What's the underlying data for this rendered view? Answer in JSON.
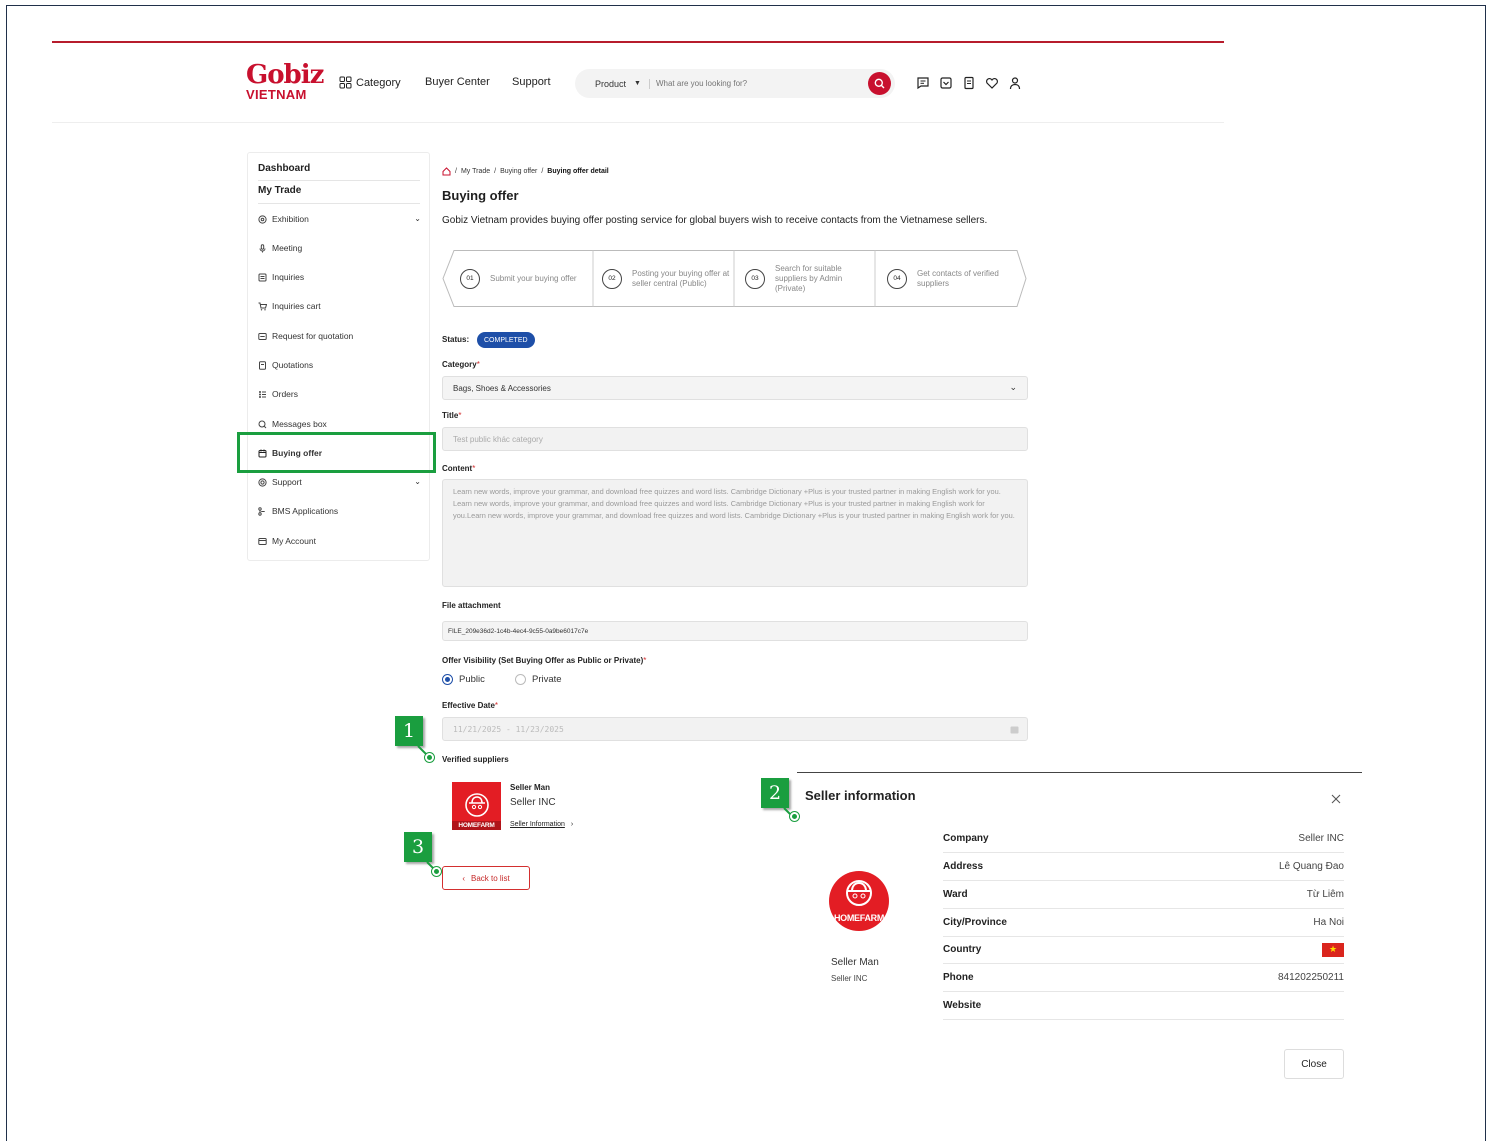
{
  "header": {
    "logo_line1": "Gobiz",
    "logo_line2": "VIETNAM",
    "nav": [
      "Category",
      "Buyer Center",
      "Support"
    ],
    "search_scope": "Product",
    "search_placeholder": "What are you looking for?"
  },
  "sidebar": {
    "dashboard": "Dashboard",
    "my_trade": "My Trade",
    "items": [
      {
        "label": "Exhibition",
        "icon": "gear-icon",
        "expandable": true
      },
      {
        "label": "Meeting",
        "icon": "mic-icon"
      },
      {
        "label": "Inquiries",
        "icon": "inbox-icon"
      },
      {
        "label": "Inquiries cart",
        "icon": "cart-icon"
      },
      {
        "label": "Request for quotation",
        "icon": "request-icon"
      },
      {
        "label": "Quotations",
        "icon": "quote-icon"
      },
      {
        "label": "Orders",
        "icon": "orders-icon"
      },
      {
        "label": "Messages box",
        "icon": "messages-icon"
      },
      {
        "label": "Buying offer",
        "icon": "offer-icon",
        "active": true
      },
      {
        "label": "Support",
        "icon": "support-icon",
        "expandable": true
      },
      {
        "label": "BMS Applications",
        "icon": "apps-icon"
      },
      {
        "label": "My Account",
        "icon": "account-icon"
      }
    ]
  },
  "breadcrumb": [
    "My Trade",
    "Buying offer",
    "Buying offer detail"
  ],
  "page": {
    "title": "Buying offer",
    "intro": "Gobiz Vietnam provides buying offer posting service for global buyers wish to receive contacts from the Vietnamese sellers."
  },
  "steps": [
    {
      "num": "01",
      "text": "Submit your buying offer"
    },
    {
      "num": "02",
      "text": "Posting your buying offer at seller central (Public)"
    },
    {
      "num": "03",
      "text": "Search for suitable suppliers by Admin (Private)"
    },
    {
      "num": "04",
      "text": "Get contacts of verified suppliers"
    }
  ],
  "form": {
    "status_label": "Status:",
    "status_value": "COMPLETED",
    "category_label": "Category",
    "category_value": "Bags, Shoes & Accessories",
    "title_label": "Title",
    "title_value": "Test public khác category",
    "content_label": "Content",
    "content_value": "Learn new words, improve your grammar, and download free quizzes and word lists. Cambridge Dictionary +Plus is your trusted partner in making English work for you.\nLearn new words, improve your grammar, and download free quizzes and word lists. Cambridge Dictionary +Plus is your trusted partner in making English work for you.Learn new words, improve your grammar, and download free quizzes and word lists. Cambridge Dictionary +Plus is your trusted partner in making English work for you.",
    "file_label": "File attachment",
    "file_value": "FILE_209e36d2-1c4b-4ec4-9c55-0a9be6017c7e",
    "visibility_label": "Offer Visibility (Set Buying Offer as Public or Private)",
    "visibility_options": [
      "Public",
      "Private"
    ],
    "visibility_selected": "Public",
    "date_label": "Effective Date",
    "date_value": "11/21/2025 - 11/23/2025",
    "verified_label": "Verified suppliers"
  },
  "supplier": {
    "logo_text": "HOMEFARM",
    "name": "Seller Man",
    "company": "Seller INC",
    "link": "Seller Information"
  },
  "back_button": "Back to list",
  "markers": [
    "1",
    "2",
    "3"
  ],
  "modal": {
    "title": "Seller information",
    "avatar_text": "HOMEFARM",
    "name": "Seller Man",
    "company_sub": "Seller INC",
    "rows": [
      {
        "key": "Company",
        "value": "Seller INC"
      },
      {
        "key": "Address",
        "value": "Lê Quang Đao"
      },
      {
        "key": "Ward",
        "value": "Từ Liêm"
      },
      {
        "key": "City/Province",
        "value": "Ha Noi"
      },
      {
        "key": "Country",
        "value": ""
      },
      {
        "key": "Phone",
        "value": "841202250211"
      },
      {
        "key": "Website",
        "value": ""
      }
    ],
    "close": "Close"
  },
  "colors": {
    "brand": "#c8102e",
    "accent": "#1e4fa8",
    "marker": "#1a9e3f"
  }
}
